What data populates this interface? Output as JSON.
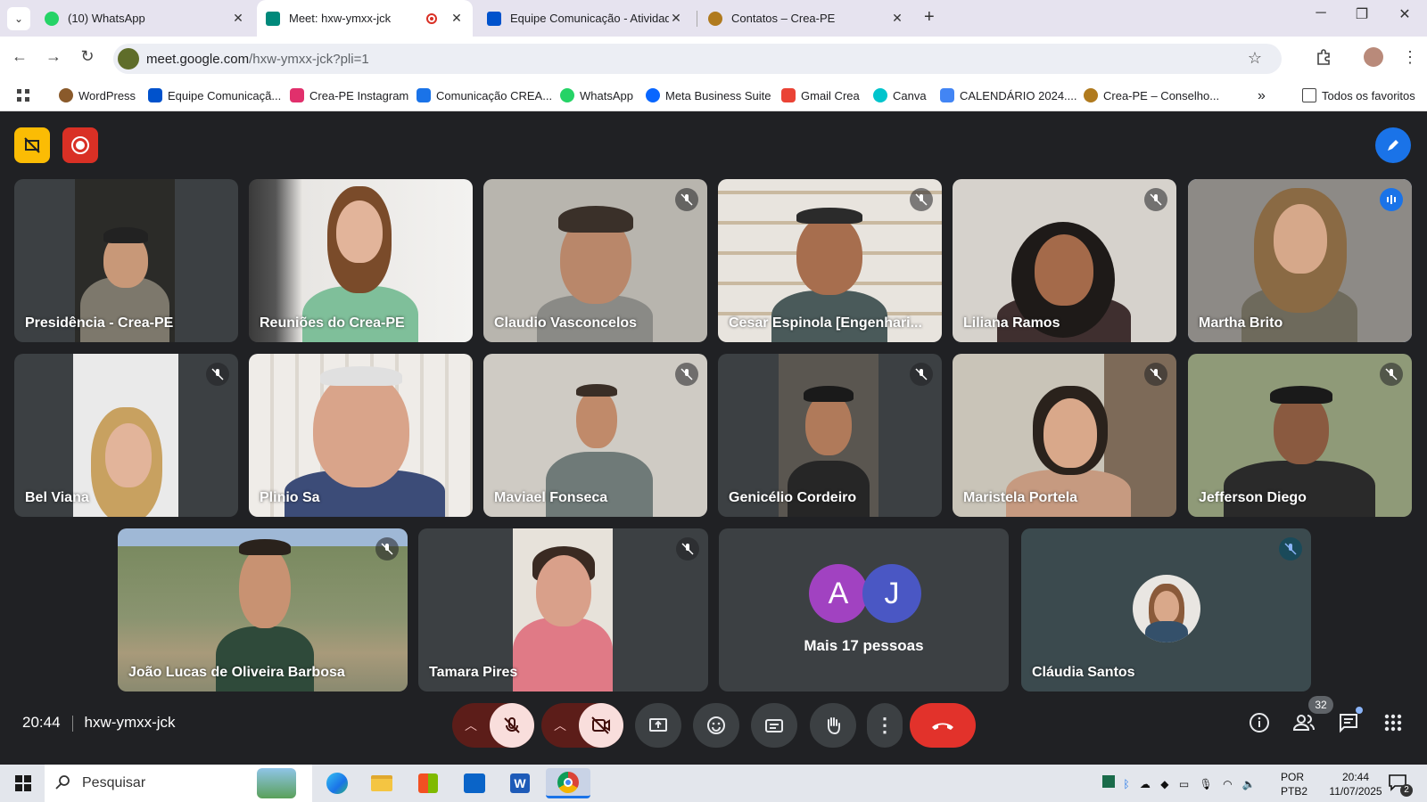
{
  "browser": {
    "tabs": [
      {
        "label": "(10) WhatsApp",
        "color": "#25d366"
      },
      {
        "label": "Meet: hxw-ymxx-jck",
        "color": "#00897b"
      },
      {
        "label": "Equipe Comunicação - Atividad",
        "color": "#0052cc"
      },
      {
        "label": "Contatos – Crea-PE",
        "color": "#b07a1e"
      }
    ],
    "url_domain": "meet.google.com",
    "url_path": "/hxw-ymxx-jck?pli=1",
    "bookmarks": [
      {
        "label": "WordPress",
        "color": "#8a5a2b"
      },
      {
        "label": "Equipe Comunicaçã...",
        "color": "#0052cc"
      },
      {
        "label": "Crea-PE Instagram",
        "color": "#e1306c"
      },
      {
        "label": "Comunicação CREA...",
        "color": "#1a73e8"
      },
      {
        "label": "WhatsApp",
        "color": "#25d366"
      },
      {
        "label": "Meta Business Suite",
        "color": "#0866ff"
      },
      {
        "label": "Gmail Crea",
        "color": "#ea4335"
      },
      {
        "label": "Canva",
        "color": "#00c4cc"
      },
      {
        "label": "CALENDÁRIO 2024....",
        "color": "#4285f4"
      },
      {
        "label": "Crea-PE – Conselho...",
        "color": "#b07a1e"
      }
    ],
    "all_bookmarks_label": "Todos os favoritos"
  },
  "meet": {
    "participants": [
      {
        "name": "Presidência - Crea-PE",
        "muted": false,
        "speaking": false
      },
      {
        "name": "Reuniões do Crea-PE",
        "muted": false,
        "speaking": false
      },
      {
        "name": "Claudio Vasconcelos",
        "muted": true,
        "speaking": false
      },
      {
        "name": "Cesar Espinola [Engenhari...",
        "muted": true,
        "speaking": false
      },
      {
        "name": "Liliana Ramos",
        "muted": true,
        "speaking": false
      },
      {
        "name": "Martha Brito",
        "muted": false,
        "speaking": true
      },
      {
        "name": "Bel Viana",
        "muted": true,
        "speaking": false
      },
      {
        "name": "Plinio Sa",
        "muted": false,
        "speaking": false
      },
      {
        "name": "Maviael Fonseca",
        "muted": true,
        "speaking": false
      },
      {
        "name": "Genicélio Cordeiro",
        "muted": true,
        "speaking": false
      },
      {
        "name": "Maristela Portela",
        "muted": true,
        "speaking": false
      },
      {
        "name": "Jefferson Diego",
        "muted": true,
        "speaking": false
      },
      {
        "name": "João Lucas de Oliveira Barbosa",
        "muted": true,
        "speaking": false
      },
      {
        "name": "Tamara Pires",
        "muted": true,
        "speaking": false
      },
      {
        "name": "Cláudia Santos",
        "muted": true,
        "speaking": false
      }
    ],
    "more_people": {
      "label": "Mais 17 pessoas",
      "avatars": [
        {
          "letter": "A",
          "color": "#a142c1"
        },
        {
          "letter": "J",
          "color": "#4a57c4"
        }
      ]
    },
    "time": "20:44",
    "meeting_code": "hxw-ymxx-jck",
    "participant_count": "32",
    "accent_red": "#ea4335",
    "end_call_color": "#e2322b"
  },
  "taskbar": {
    "search_placeholder": "Pesquisar",
    "lang_line1": "POR",
    "lang_line2": "PTB2",
    "clock_time": "20:44",
    "clock_date": "11/07/2025",
    "notification_count": "2"
  }
}
